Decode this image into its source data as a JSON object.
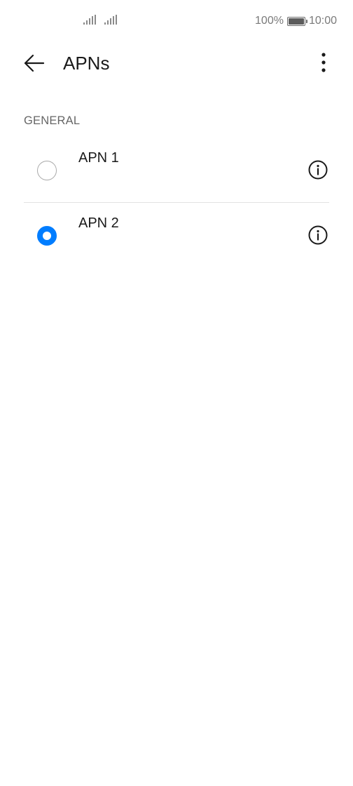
{
  "status_bar": {
    "battery_percent": "100%",
    "battery_level": 1.0,
    "time": "10:00",
    "signal_icons": [
      "signal-sim1-icon",
      "signal-sim2-icon"
    ]
  },
  "header": {
    "title": "APNs",
    "back_icon": "arrow-left-icon",
    "more_icon": "more-vertical-icon"
  },
  "section": {
    "label": "GENERAL"
  },
  "apns": [
    {
      "name": "APN 1",
      "selected": false,
      "info_icon": "info-icon"
    },
    {
      "name": "APN 2",
      "selected": true,
      "info_icon": "info-icon"
    }
  ],
  "colors": {
    "accent": "#007dff",
    "text_primary": "#1a1a1a",
    "text_secondary": "#666666",
    "divider": "#e3e3e3"
  }
}
